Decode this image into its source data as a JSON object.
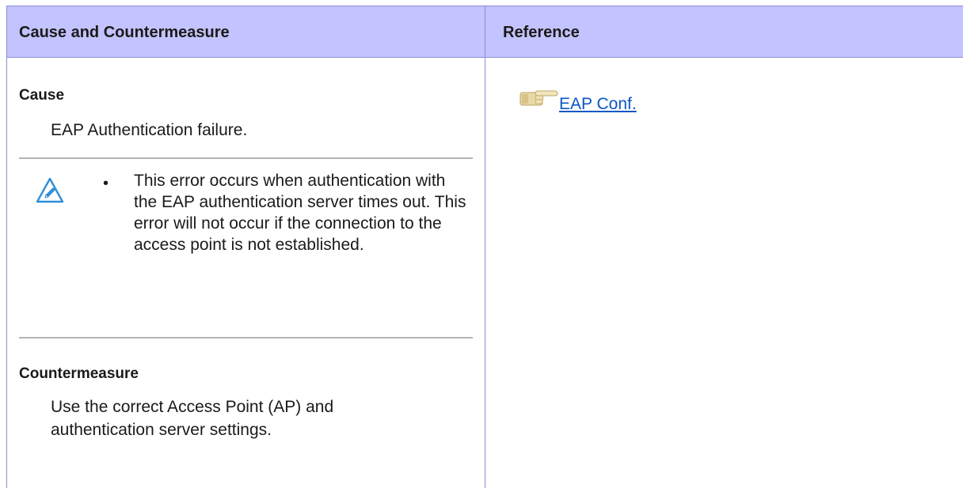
{
  "header": {
    "cause_title": "Cause and Countermeasure",
    "reference_title": "Reference"
  },
  "cause": {
    "label": "Cause",
    "text": "EAP Authentication failure."
  },
  "note": {
    "icon": "pencil-note-icon",
    "bullet": "•",
    "text": "This error occurs when authentication with the EAP authentication server times out. This error will not occur if the connection to the access point is not established."
  },
  "countermeasure": {
    "label": "Countermeasure",
    "text": "Use the correct Access Point (AP) and authentication server settings."
  },
  "reference": {
    "icon": "pointing-hand-icon",
    "link_text": "EAP Conf."
  },
  "colors": {
    "header_bg": "#c3c3ff",
    "border": "#8c8cd8",
    "link": "#0a56c4",
    "icon_blue": "#2f8fd8"
  }
}
